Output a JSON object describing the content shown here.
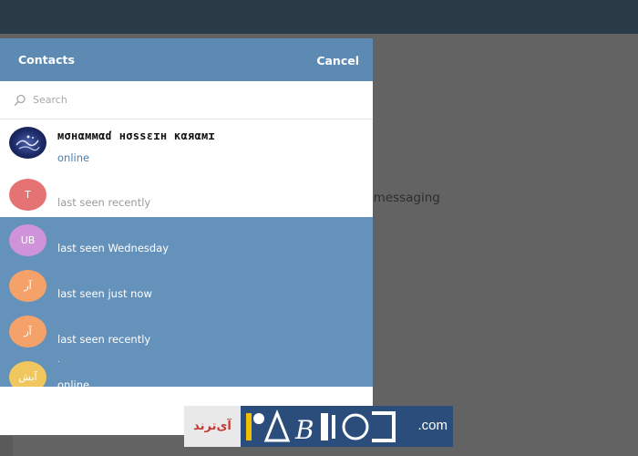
{
  "background": {
    "partial_text": "t messaging"
  },
  "modal": {
    "title": "Contacts",
    "cancel_label": "Cancel",
    "search": {
      "placeholder": "Search",
      "value": ""
    },
    "contacts": [
      {
        "avatar_text": "",
        "avatar_color": "#1d2a66",
        "name": "мσнαммαɗ нσssεɪн кαяαмɪ",
        "status": "online"
      },
      {
        "avatar_text": "T",
        "avatar_color": "#e57373",
        "name": "",
        "status": "last seen recently"
      },
      {
        "avatar_text": "UB",
        "avatar_color": "#ce93d8",
        "name": "",
        "status": "last seen Wednesday"
      },
      {
        "avatar_text": "آر",
        "avatar_color": "#f5a26a",
        "name": "",
        "status": "last seen just now"
      },
      {
        "avatar_text": "آر",
        "avatar_color": "#f5a26a",
        "name": "",
        "status": "last seen recently"
      },
      {
        "avatar_text": "آبش",
        "avatar_color": "#f0c75e",
        "name": ".",
        "status": "online"
      }
    ]
  },
  "watermark": {
    "persian_text": "آی‌ترند",
    "domain_suffix": ".com"
  },
  "colors": {
    "header": "#5d8ab3",
    "selected_rows": "#6592bb",
    "topbar": "#2b3a47",
    "online_text": "#4a7eaf"
  }
}
